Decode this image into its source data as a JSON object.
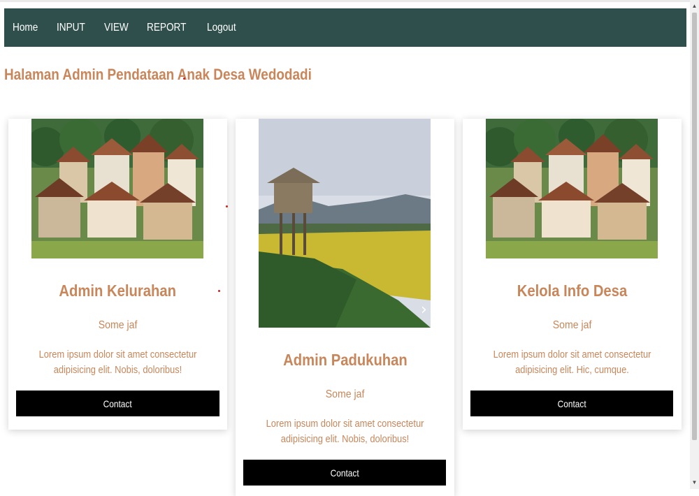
{
  "nav": {
    "items": [
      "Home",
      "INPUT",
      "VIEW",
      "REPORT",
      "Logout"
    ]
  },
  "page": {
    "title": "Halaman Admin Pendataan Anak Desa Wedodadi"
  },
  "cards": [
    {
      "title": "Admin Kelurahan",
      "subtitle": "Some jaf",
      "text": "Lorem ipsum dolor sit amet consectetur adipisicing elit. Nobis, doloribus!",
      "button": "Contact",
      "image": "village-photo"
    },
    {
      "title": "Admin Padukuhan",
      "subtitle": "Some jaf",
      "text": "Lorem ipsum dolor sit amet consectetur adipisicing elit. Nobis, doloribus!",
      "button": "Contact",
      "image": "rice-field-photo"
    },
    {
      "title": "Kelola Info Desa",
      "subtitle": "Some jaf",
      "text": "Lorem ipsum dolor sit amet consectetur adipisicing elit. Hic, cumque.",
      "button": "Contact",
      "image": "village-photo"
    }
  ],
  "colors": {
    "navbar": "#2e4f4b",
    "accent": "#c8865a",
    "button": "#000000"
  }
}
